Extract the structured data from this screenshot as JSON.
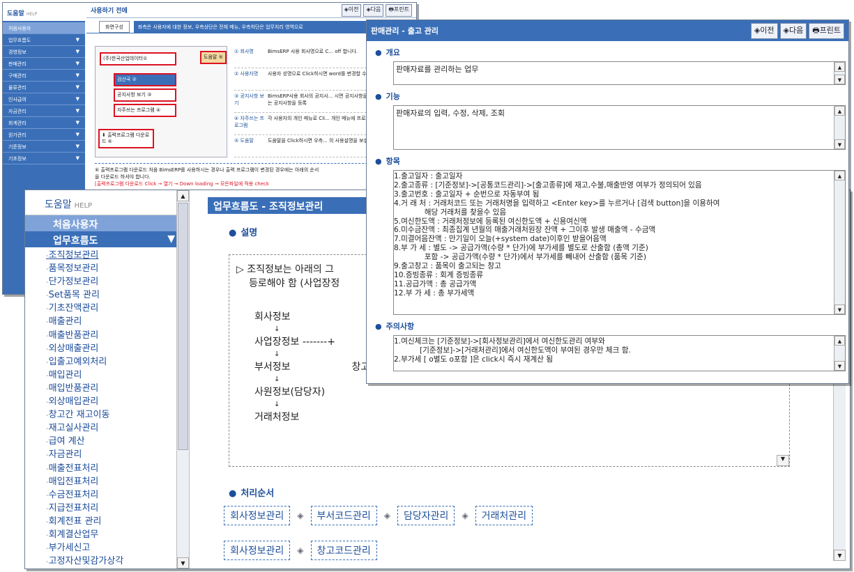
{
  "w1": {
    "logo": "도움말",
    "logo_sub": "HELP",
    "side": [
      "처음사용자",
      "업무흐름도",
      "경영정보",
      "판매관리",
      "구매관리",
      "물류관리",
      "인사급여",
      "자금관리",
      "회계관리",
      "원가관리",
      "기준정보",
      "기초정보"
    ],
    "title": "사용하기 전에",
    "btn_prev": "◈이전",
    "btn_next": "◈다음",
    "btn_print": "프린트",
    "tab": "화면구성",
    "tabdesc": "좌측은 사용자에 대한 정보, 우측상단은 전체 메뉴, 우측하단은 업무처리 영역으로",
    "shot_items": [
      "(주)한국산업데이터①",
      "검산국 ②",
      "공지사항 보기 ③",
      "자주쓰는 프로그램 ④",
      "도움말 ⑤",
      "출력프로그램 다운로드 ⑥"
    ],
    "desc": [
      {
        "k": "① 회사명",
        "v": "BimsERP 사용 회사명으로 C... off 합니다."
      },
      {
        "k": "② 사용자명",
        "v": "사용자 성명으로 Click하시면 word를 변경할 수 있습니다."
      },
      {
        "k": "③ 공지사항 보기",
        "v": "BimsERP사용 회사의 공지사... 시면 공지사항을 보실수 있... 된 사용자는 공지사항을 등록"
      },
      {
        "k": "④ 자주쓰는 프로그램",
        "v": "각 사용자의 개인 메뉴로 Cli... 개인 메뉴에 프로그램을 등록... 니다."
      },
      {
        "k": "⑤ 도움말",
        "v": "도움말을 Click하시면 우측... 의 사용설명을 보실수 있습니"
      }
    ],
    "note1": "⑥ 출력프로그램 다운로드   처음 BimsERP를 사용하시는 경우나 출력 프로그램이 변경된 경우에는 아래의 순서",
    "note2": "을 다운로드 하셔야 합니다.",
    "note3": "[출력프로그램 다운로드 Click → 열기 → Down loading → 모든파일에 적용 check"
  },
  "w2": {
    "logo": "도움말",
    "logo_sub": "HELP",
    "beg": "처음사용자",
    "flow": "업무흐름도",
    "tree": [
      "조직정보관리",
      "품목정보관리",
      "단가정보관리",
      "Set품목 관리",
      "기초잔액관리",
      "매출관리",
      "매출반품관리",
      "외상매출관리",
      "입출고예외처리",
      "매입관리",
      "매입반품관리",
      "외상매입관리",
      "창고간 재고이동",
      "재고실사관리",
      "급여 계산",
      "자금관리",
      "매출전표처리",
      "매입전표처리",
      "수금전표처리",
      "지급전표처리",
      "회계전표 관리",
      "회계결산업무",
      "부가세신고",
      "고정자산및감가상각"
    ],
    "title": "업무흐름도 - 조직정보관리",
    "sec_desc": "설명",
    "desc_line1": "▷ 조직정보는 아래의 그",
    "desc_line2": "등로해야 함 (사업장정",
    "org": [
      "회사정보",
      "사업장정보 -------+",
      "부서정보",
      "창고",
      "사원정보(담당자)",
      "거래처정보"
    ],
    "sec_proc": "처리순서",
    "proc_row1": [
      "회사정보관리",
      "부서코드관리",
      "담당자관리",
      "거래처관리"
    ],
    "proc_row2": [
      "회사정보관리",
      "창고코드관리"
    ]
  },
  "w3": {
    "title": "판매관리 - 출고 관리",
    "btn_prev": "◈이전",
    "btn_next": "◈다음",
    "btn_print": "프린트",
    "sec_overview": "개요",
    "overview": "판매자료를 관리하는 업무",
    "sec_func": "기능",
    "func": "판매자료의 입력, 수정, 삭제, 조회",
    "sec_items": "항목",
    "items": [
      "1.출고일자 : 출고일자",
      "2.출고종류 : [기준정보]->[공통코드관리]->[출고종류]에 재고,수불,매출반영 여부가 정의되어 있음",
      "3.출고번호 : 출고일자 + 순번으로 자동부여 됨",
      "4.거 래 처 : 거래처코드 또는 거래처명을 입력하고 <Enter key>를 누르거나 [검색 button]을 이용하여",
      "             해당 거래처를 찾을수 있음",
      "5.여신한도액 : 거래처정보에 등록된 여신한도액 + 신용여신액",
      "6.미수금잔액 : 최종집계 년월의 매출거래처원장 잔액 + 그이후 발생 매출액 - 수금액",
      "7.미결어음잔액 : 만기일이 오늘(+system date)이후인 받을어음액",
      "8.부 가 세 : 별도 -> 공급가액(수량 * 단가)에 부가세를 별도로 산출함 (총액 기준)",
      "             포함 -> 공급가액(수량 * 단가)에서 부가세를 빼내어 산출함 (품목 기준)",
      "9.출고창고 : 품목이 출고되는 창고",
      "10.증빙종류 : 회계 증빙종류",
      "11.공급가액 : 총 공급가액",
      "12.부 가 세 : 총 부가세액"
    ],
    "sec_notes": "주의사항",
    "notes": [
      "1.여신체크는 [기준정보]->[회사정보관리]에서 여신한도관리 여부와",
      "           [기준정보]->[거래처관리]에서 여신한도액이 부여된 경우만 체크 함.",
      "2.부가세 [ o별도 o포함 ]은 click시 즉시 재계산 됨"
    ]
  }
}
